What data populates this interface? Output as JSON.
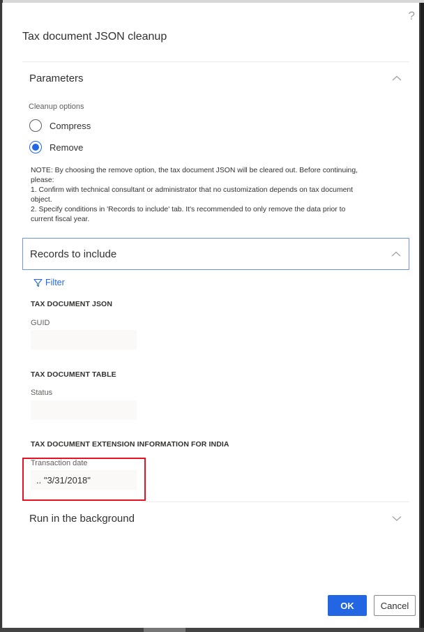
{
  "dialog": {
    "title": "Tax document JSON cleanup",
    "help_icon": "?"
  },
  "parameters": {
    "header": "Parameters",
    "expanded": true,
    "cleanup_options_label": "Cleanup options",
    "options": [
      {
        "label": "Compress",
        "selected": false
      },
      {
        "label": "Remove",
        "selected": true
      }
    ],
    "note_lines": [
      "NOTE: By choosing the remove option, the tax document JSON will be cleared out. Before continuing, please:",
      "1. Confirm with technical consultant or administrator that no customization depends on tax document object.",
      "2. Specify conditions in 'Records to include' tab. It's recommended to only remove the data prior to current fiscal year."
    ]
  },
  "records": {
    "header": "Records to include",
    "expanded": true,
    "filter_label": "Filter",
    "groups": [
      {
        "title": "TAX DOCUMENT JSON",
        "field_label": "GUID",
        "value": ""
      },
      {
        "title": "TAX DOCUMENT TABLE",
        "field_label": "Status",
        "value": ""
      },
      {
        "title": "TAX DOCUMENT EXTENSION INFORMATION FOR INDIA",
        "field_label": "Transaction date",
        "value": ".. \"3/31/2018\""
      }
    ]
  },
  "background": {
    "header": "Run in the background",
    "expanded": false
  },
  "footer": {
    "ok_label": "OK",
    "cancel_label": "Cancel"
  },
  "colors": {
    "accent": "#2266e3",
    "highlight_box": "#e81123"
  }
}
